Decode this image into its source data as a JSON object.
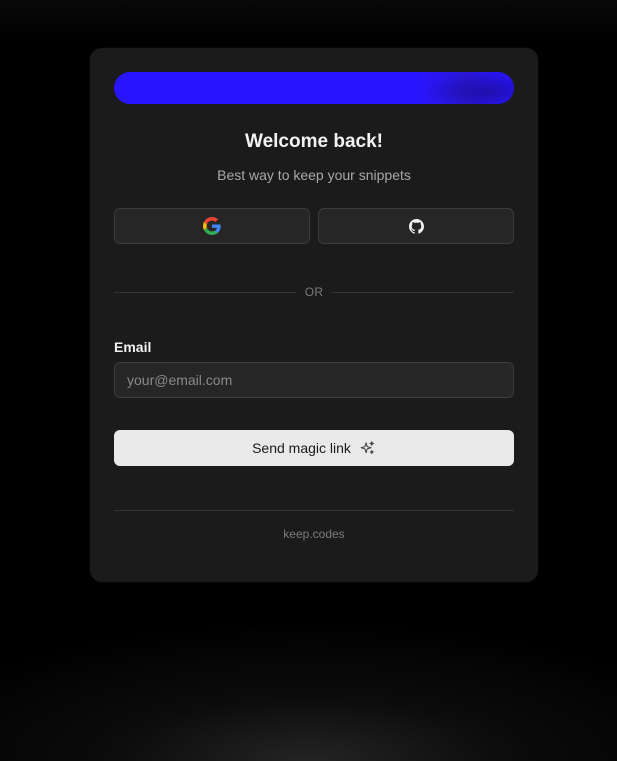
{
  "card": {
    "title": "Welcome back!",
    "subtitle": "Best way to keep your snippets"
  },
  "oauth": {
    "google": {
      "icon": "google-icon"
    },
    "github": {
      "icon": "github-icon"
    }
  },
  "divider": {
    "text": "OR"
  },
  "email": {
    "label": "Email",
    "value": "",
    "placeholder": "your@email.com"
  },
  "submit": {
    "label": "Send magic link",
    "icon": "sparkles-icon"
  },
  "footer": {
    "text": "keep.codes"
  },
  "colors": {
    "banner": "#2a14ff",
    "card_bg": "#1b1b1b",
    "page_bg": "#000000",
    "button_light": "#e9e9e9"
  }
}
